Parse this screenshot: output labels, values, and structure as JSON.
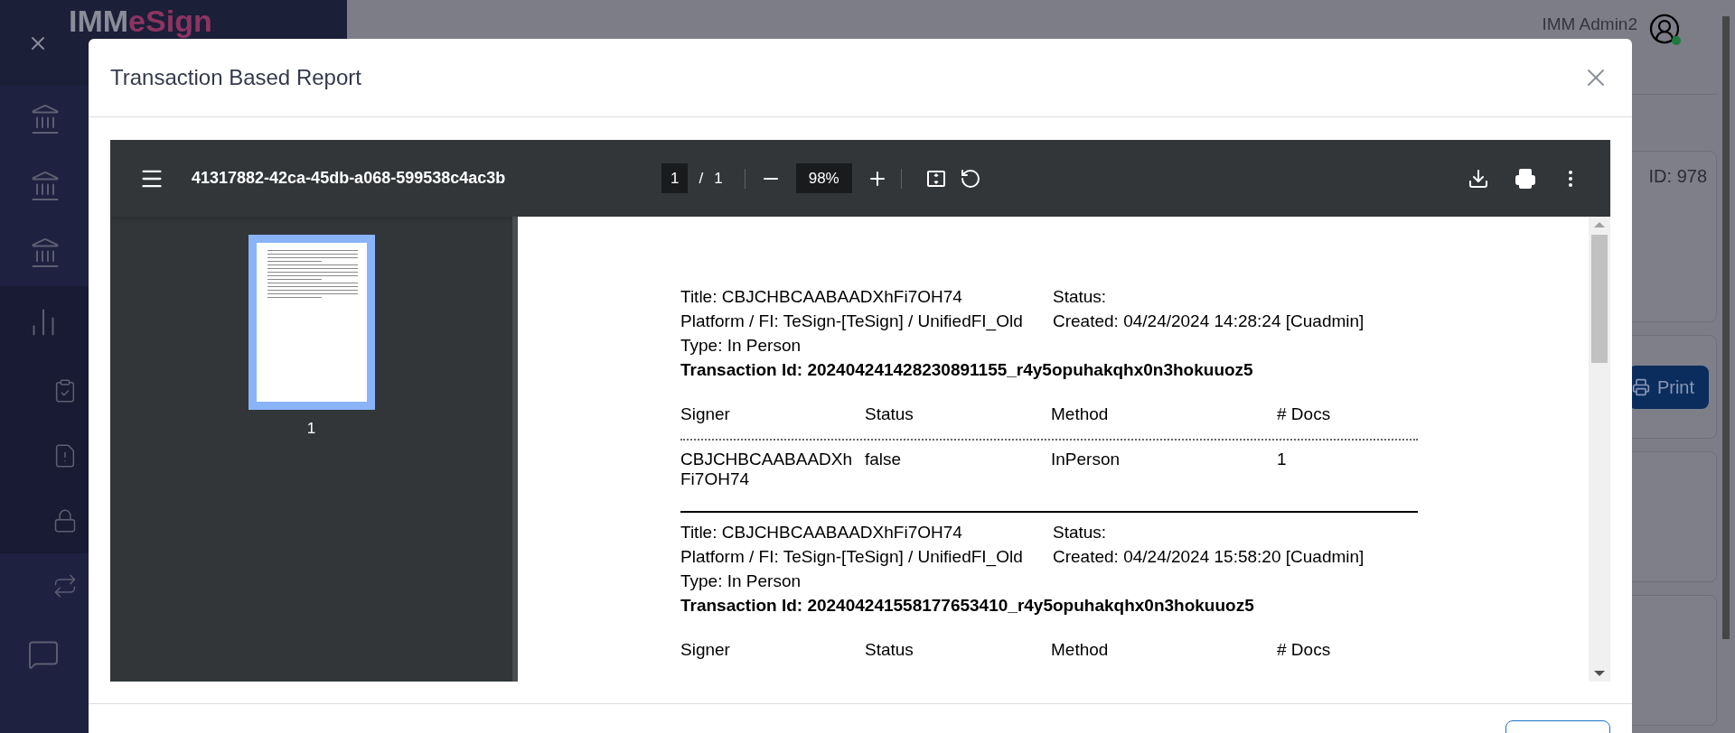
{
  "app": {
    "logo": {
      "prefix": "IMM",
      "suffix": "eSign"
    },
    "user": "IMM Admin2",
    "user_online": true,
    "id_label": "ID: 978",
    "print_button": "Print"
  },
  "modal": {
    "title": "Transaction Based Report",
    "pdf_viewer": {
      "filename": "41317882-42ca-45db-a068-599538c4ac3b",
      "page": "1",
      "separator": "/",
      "page_total": "1",
      "zoom": "98%",
      "thumbnails": [
        {
          "label": "1",
          "selected": true
        }
      ],
      "transactions": [
        {
          "title": "Title: CBJCHBCAABAADXhFi7OH74",
          "status": "Status:",
          "platform": "Platform / FI: TeSign-[TeSign] / UnifiedFI_Old",
          "created": "Created: 04/24/2024 14:28:24 [Cuadmin]",
          "type": "Type: In Person",
          "transaction_id": "Transaction Id: 202404241428230891155_r4y5opuhakqhx0n3hokuuoz5",
          "columns": [
            "Signer",
            "Status",
            "Method",
            "# Docs"
          ],
          "signers": [
            {
              "signer": "CBJCHBCAABAADXh",
              "signer_wrap": "Fi7OH74",
              "status": "false",
              "method": "InPerson",
              "docs": "1"
            }
          ]
        },
        {
          "title": "Title: CBJCHBCAABAADXhFi7OH74",
          "status": "Status:",
          "platform": "Platform / FI: TeSign-[TeSign] / UnifiedFI_Old",
          "created": "Created: 04/24/2024 15:58:20 [Cuadmin]",
          "type": "Type: In Person",
          "transaction_id": "Transaction Id: 202404241558177653410_r4y5opuhakqhx0n3hokuuoz5",
          "columns": [
            "Signer",
            "Status",
            "Method",
            "# Docs"
          ]
        }
      ]
    }
  }
}
